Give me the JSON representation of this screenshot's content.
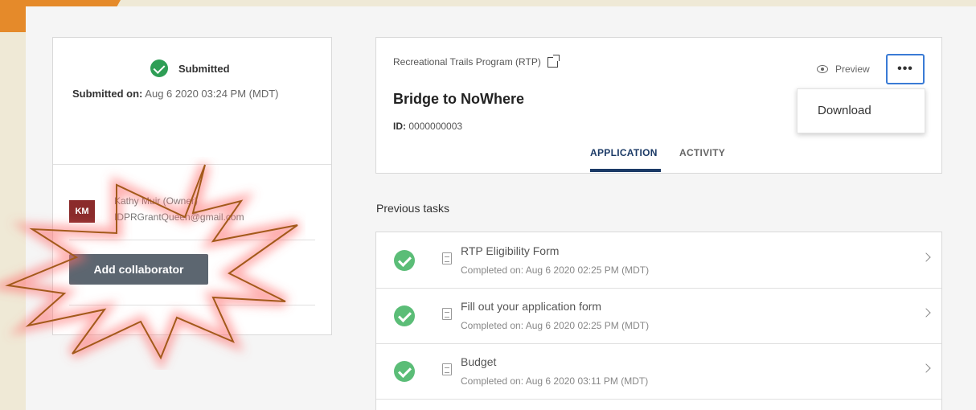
{
  "status": {
    "label": "Submitted",
    "submitted_on_label": "Submitted on:",
    "submitted_on_value": "Aug 6 2020 03:24 PM (MDT)"
  },
  "collaborators": {
    "avatar_initials": "KM",
    "owner_name": "Kathy Muir (Owner)",
    "owner_email": "IDPRGrantQueen@gmail.com",
    "add_button": "Add collaborator"
  },
  "application": {
    "program": "Recreational Trails Program (RTP)",
    "title": "Bridge to NoWhere",
    "id_label": "ID:",
    "id_value": "0000000003",
    "preview_label": "Preview",
    "more_label": "•••",
    "dropdown": [
      "Download"
    ],
    "tabs": [
      {
        "label": "APPLICATION",
        "active": true
      },
      {
        "label": "ACTIVITY",
        "active": false
      }
    ]
  },
  "tasks": {
    "title": "Previous tasks",
    "items": [
      {
        "name": "RTP Eligibility Form",
        "completed": "Completed on: Aug 6 2020 02:25 PM (MDT)"
      },
      {
        "name": "Fill out your application form",
        "completed": "Completed on: Aug 6 2020 02:25 PM (MDT)"
      },
      {
        "name": "Budget",
        "completed": "Completed on: Aug 6 2020 03:11 PM (MDT)"
      }
    ]
  },
  "colors": {
    "accent": "#1b3a66",
    "success": "#2e9e55",
    "highlight": "#3a7bd5",
    "button": "#5c6670",
    "burst_stroke": "#a35a1b",
    "burst_glow": "#ff6b6b"
  }
}
